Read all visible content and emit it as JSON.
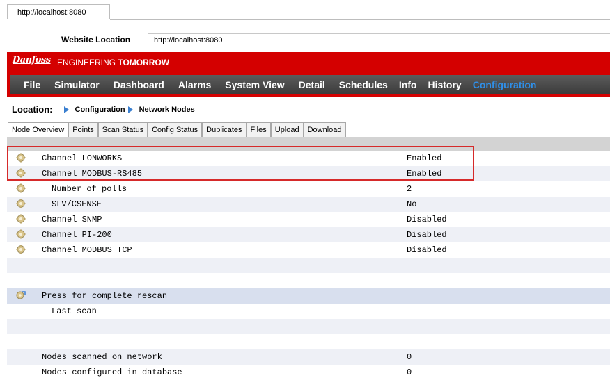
{
  "browser": {
    "tab_title": "http://localhost:8080"
  },
  "location_bar": {
    "label": "Website Location",
    "value": "http://localhost:8080"
  },
  "brand": {
    "logo_text": "Danfoss",
    "tagline_light": "ENGINEERING",
    "tagline_bold": "TOMORROW",
    "color": "#d40000"
  },
  "menu": {
    "items": [
      "File",
      "Simulator",
      "Dashboard",
      "Alarms",
      "System View",
      "Detail",
      "Schedules",
      "Info",
      "History",
      "Configuration"
    ],
    "active": "Configuration",
    "active_color": "#2f8fe8"
  },
  "breadcrumb": {
    "label": "Location:",
    "items": [
      "Configuration",
      "Network Nodes"
    ]
  },
  "subtabs": [
    "Node Overview",
    "Points",
    "Scan Status",
    "Config Status",
    "Duplicates",
    "Files",
    "Upload",
    "Download"
  ],
  "rows": [
    {
      "icon": "gear-icon",
      "name": "Channel LONWORKS",
      "value": "Enabled"
    },
    {
      "icon": "gear-icon",
      "name": "Channel MODBUS-RS485",
      "value": "Enabled"
    },
    {
      "icon": "gear-icon",
      "name": "Number of polls",
      "value": "2",
      "indent": true
    },
    {
      "icon": "gear-icon",
      "name": "SLV/CSENSE",
      "value": "No",
      "indent": true
    },
    {
      "icon": "gear-icon",
      "name": "Channel SNMP",
      "value": "Disabled"
    },
    {
      "icon": "gear-icon",
      "name": "Channel PI-200",
      "value": "Disabled"
    },
    {
      "icon": "gear-icon",
      "name": "Channel MODBUS TCP",
      "value": "Disabled"
    },
    {
      "name": "",
      "value": ""
    },
    {
      "name": "",
      "value": ""
    },
    {
      "icon": "rescan-icon",
      "name": "Press for complete rescan",
      "value": ""
    },
    {
      "name": "Last scan",
      "value": "",
      "indent": true
    },
    {
      "name": "",
      "value": ""
    },
    {
      "name": "",
      "value": ""
    },
    {
      "name": "Nodes scanned on network",
      "value": "0"
    },
    {
      "name": "Nodes configured in database",
      "value": "0"
    }
  ]
}
